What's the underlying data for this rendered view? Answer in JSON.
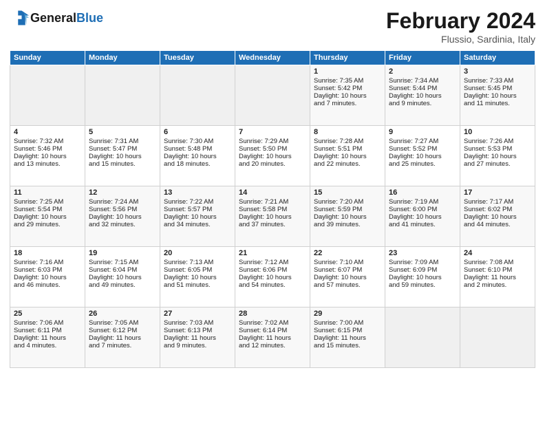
{
  "header": {
    "logo_line1": "General",
    "logo_line2": "Blue",
    "title": "February 2024",
    "subtitle": "Flussio, Sardinia, Italy"
  },
  "calendar": {
    "days_of_week": [
      "Sunday",
      "Monday",
      "Tuesday",
      "Wednesday",
      "Thursday",
      "Friday",
      "Saturday"
    ],
    "weeks": [
      [
        {
          "num": "",
          "content": ""
        },
        {
          "num": "",
          "content": ""
        },
        {
          "num": "",
          "content": ""
        },
        {
          "num": "",
          "content": ""
        },
        {
          "num": "1",
          "content": "Sunrise: 7:35 AM\nSunset: 5:42 PM\nDaylight: 10 hours\nand 7 minutes."
        },
        {
          "num": "2",
          "content": "Sunrise: 7:34 AM\nSunset: 5:44 PM\nDaylight: 10 hours\nand 9 minutes."
        },
        {
          "num": "3",
          "content": "Sunrise: 7:33 AM\nSunset: 5:45 PM\nDaylight: 10 hours\nand 11 minutes."
        }
      ],
      [
        {
          "num": "4",
          "content": "Sunrise: 7:32 AM\nSunset: 5:46 PM\nDaylight: 10 hours\nand 13 minutes."
        },
        {
          "num": "5",
          "content": "Sunrise: 7:31 AM\nSunset: 5:47 PM\nDaylight: 10 hours\nand 15 minutes."
        },
        {
          "num": "6",
          "content": "Sunrise: 7:30 AM\nSunset: 5:48 PM\nDaylight: 10 hours\nand 18 minutes."
        },
        {
          "num": "7",
          "content": "Sunrise: 7:29 AM\nSunset: 5:50 PM\nDaylight: 10 hours\nand 20 minutes."
        },
        {
          "num": "8",
          "content": "Sunrise: 7:28 AM\nSunset: 5:51 PM\nDaylight: 10 hours\nand 22 minutes."
        },
        {
          "num": "9",
          "content": "Sunrise: 7:27 AM\nSunset: 5:52 PM\nDaylight: 10 hours\nand 25 minutes."
        },
        {
          "num": "10",
          "content": "Sunrise: 7:26 AM\nSunset: 5:53 PM\nDaylight: 10 hours\nand 27 minutes."
        }
      ],
      [
        {
          "num": "11",
          "content": "Sunrise: 7:25 AM\nSunset: 5:54 PM\nDaylight: 10 hours\nand 29 minutes."
        },
        {
          "num": "12",
          "content": "Sunrise: 7:24 AM\nSunset: 5:56 PM\nDaylight: 10 hours\nand 32 minutes."
        },
        {
          "num": "13",
          "content": "Sunrise: 7:22 AM\nSunset: 5:57 PM\nDaylight: 10 hours\nand 34 minutes."
        },
        {
          "num": "14",
          "content": "Sunrise: 7:21 AM\nSunset: 5:58 PM\nDaylight: 10 hours\nand 37 minutes."
        },
        {
          "num": "15",
          "content": "Sunrise: 7:20 AM\nSunset: 5:59 PM\nDaylight: 10 hours\nand 39 minutes."
        },
        {
          "num": "16",
          "content": "Sunrise: 7:19 AM\nSunset: 6:00 PM\nDaylight: 10 hours\nand 41 minutes."
        },
        {
          "num": "17",
          "content": "Sunrise: 7:17 AM\nSunset: 6:02 PM\nDaylight: 10 hours\nand 44 minutes."
        }
      ],
      [
        {
          "num": "18",
          "content": "Sunrise: 7:16 AM\nSunset: 6:03 PM\nDaylight: 10 hours\nand 46 minutes."
        },
        {
          "num": "19",
          "content": "Sunrise: 7:15 AM\nSunset: 6:04 PM\nDaylight: 10 hours\nand 49 minutes."
        },
        {
          "num": "20",
          "content": "Sunrise: 7:13 AM\nSunset: 6:05 PM\nDaylight: 10 hours\nand 51 minutes."
        },
        {
          "num": "21",
          "content": "Sunrise: 7:12 AM\nSunset: 6:06 PM\nDaylight: 10 hours\nand 54 minutes."
        },
        {
          "num": "22",
          "content": "Sunrise: 7:10 AM\nSunset: 6:07 PM\nDaylight: 10 hours\nand 57 minutes."
        },
        {
          "num": "23",
          "content": "Sunrise: 7:09 AM\nSunset: 6:09 PM\nDaylight: 10 hours\nand 59 minutes."
        },
        {
          "num": "24",
          "content": "Sunrise: 7:08 AM\nSunset: 6:10 PM\nDaylight: 11 hours\nand 2 minutes."
        }
      ],
      [
        {
          "num": "25",
          "content": "Sunrise: 7:06 AM\nSunset: 6:11 PM\nDaylight: 11 hours\nand 4 minutes."
        },
        {
          "num": "26",
          "content": "Sunrise: 7:05 AM\nSunset: 6:12 PM\nDaylight: 11 hours\nand 7 minutes."
        },
        {
          "num": "27",
          "content": "Sunrise: 7:03 AM\nSunset: 6:13 PM\nDaylight: 11 hours\nand 9 minutes."
        },
        {
          "num": "28",
          "content": "Sunrise: 7:02 AM\nSunset: 6:14 PM\nDaylight: 11 hours\nand 12 minutes."
        },
        {
          "num": "29",
          "content": "Sunrise: 7:00 AM\nSunset: 6:15 PM\nDaylight: 11 hours\nand 15 minutes."
        },
        {
          "num": "",
          "content": ""
        },
        {
          "num": "",
          "content": ""
        }
      ]
    ]
  }
}
